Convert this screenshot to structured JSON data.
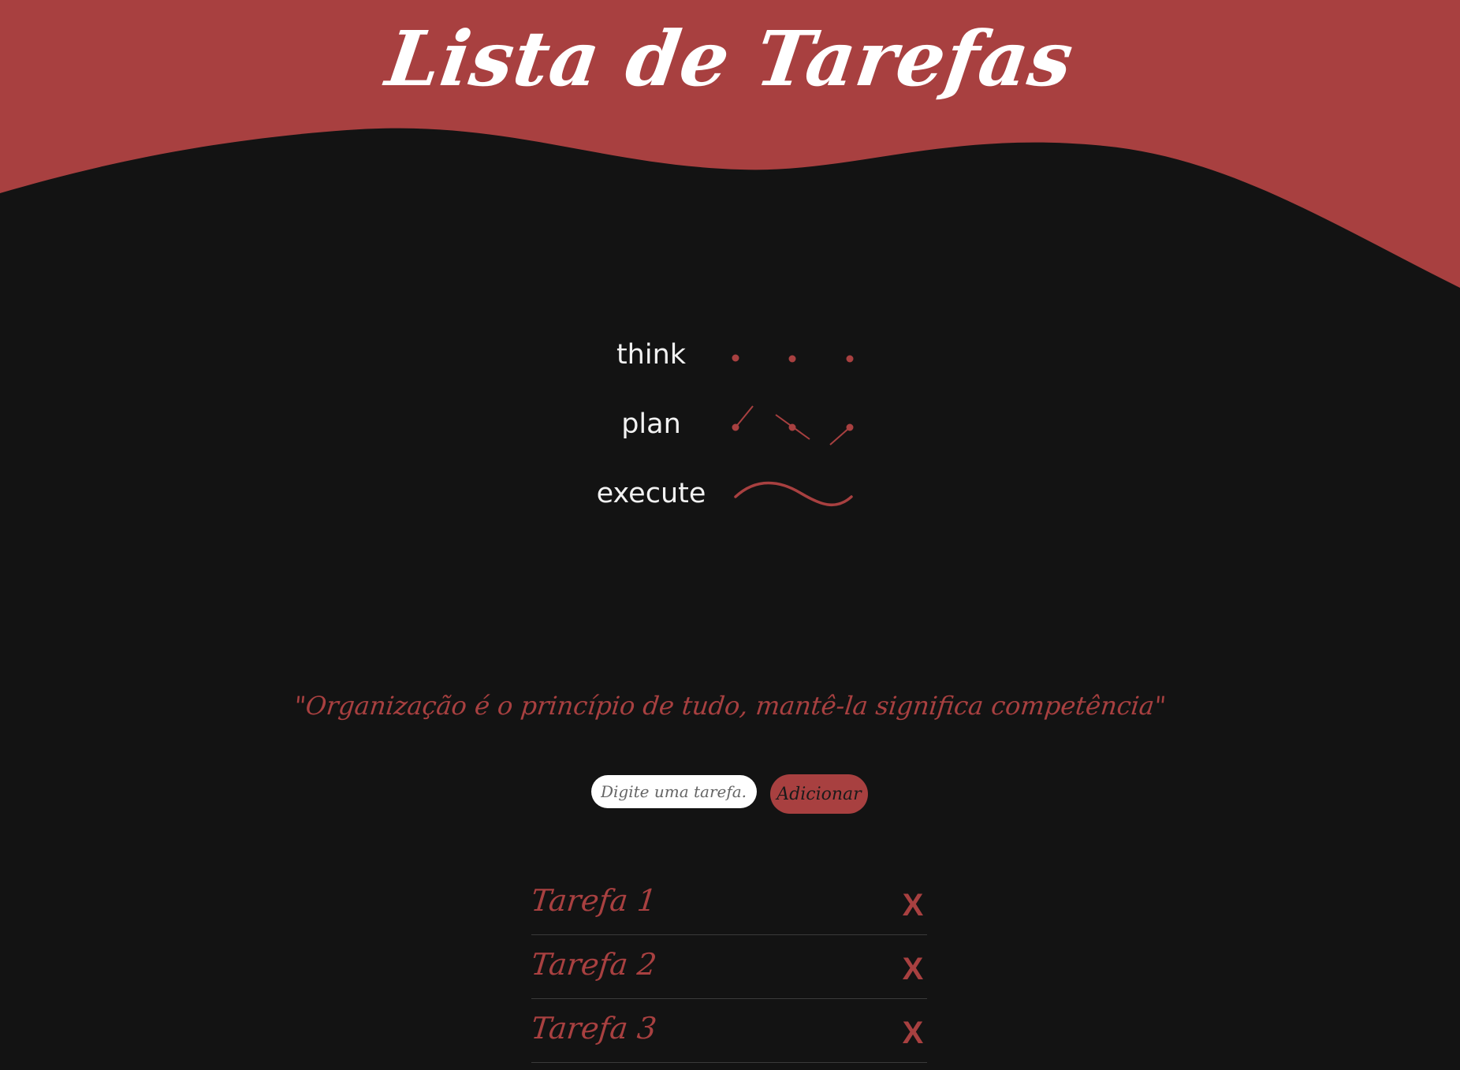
{
  "colors": {
    "accent": "#a84040",
    "background": "#131313",
    "text": "#f2f2f2"
  },
  "header": {
    "title": "Lista de Tarefas"
  },
  "workflow": {
    "steps": [
      {
        "label": "think"
      },
      {
        "label": "plan"
      },
      {
        "label": "execute"
      }
    ]
  },
  "quote": "\"Organização é o princípio de tudo, mantê-la significa competência\"",
  "task_form": {
    "placeholder": "Digite uma tarefa...",
    "add_label": "Adicionar"
  },
  "tasks": [
    {
      "label": "Tarefa 1",
      "delete_label": "X"
    },
    {
      "label": "Tarefa 2",
      "delete_label": "X"
    },
    {
      "label": "Tarefa 3",
      "delete_label": "X"
    }
  ]
}
